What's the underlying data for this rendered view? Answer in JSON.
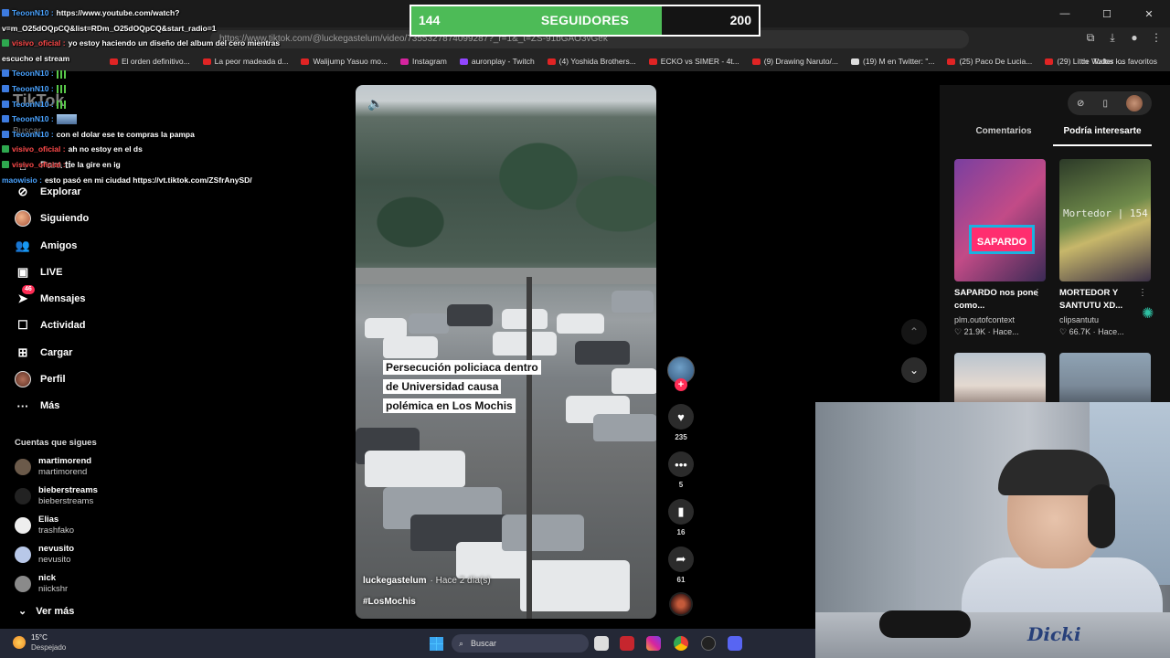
{
  "browser": {
    "url": "https://www.tiktok.com/@luckegastelum/video/7355327874099287?_r=1&_t=ZS-91bGAO3vGek",
    "window_controls": [
      "—",
      "☐",
      "✕"
    ],
    "bookmarks": [
      "El orden definitivo...",
      "La peor madeada d...",
      "Walijump Yasuo mo...",
      "Instagram",
      "auronplay - Twitch",
      "(4) Yoshida Brothers...",
      "ECKO vs SIMER - 4t...",
      "(9) Drawing Naruto/...",
      "(19) M en Twitter: \"...",
      "(25) Paco De Lucia...",
      "(29) Little Walter -..."
    ],
    "all_bookmarks": "Todos los favoritos"
  },
  "follower_goal": {
    "current": "144",
    "label": "SEGUIDORES",
    "goal": "200",
    "progress": 0.72,
    "fill_color": "#4dbb57"
  },
  "chat": [
    {
      "user": "TeoonN10 :",
      "msg": "https://www.youtube.com/watch?",
      "badge": "blue"
    },
    {
      "user": "",
      "msg": "v=m_O25dOQpCQ&list=RDm_O25dOQpCQ&start_radio=1",
      "badge": "none"
    },
    {
      "user": "visivo_oficial :",
      "msg": "yo estoy haciendo un diseño del album del cero mientras",
      "badge": "green"
    },
    {
      "user": "",
      "msg": "escucho el stream",
      "badge": "none"
    },
    {
      "user": "TeoonN10 :",
      "msg": "",
      "badge": "blue",
      "extra": "signal"
    },
    {
      "user": "TeoonN10 :",
      "msg": "",
      "badge": "blue",
      "extra": "signal"
    },
    {
      "user": "TeoonN10 :",
      "msg": "",
      "badge": "blue",
      "extra": "signal"
    },
    {
      "user": "TeoonN10 :",
      "msg": "",
      "badge": "blue",
      "extra": "emote"
    },
    {
      "user": "TeoonN10 :",
      "msg": "con el dolar ese te compras la pampa",
      "badge": "blue"
    },
    {
      "user": "visivo_oficial :",
      "msg": "ah no estoy en el ds",
      "badge": "green"
    },
    {
      "user": "visivo_oficial :",
      "msg": "te la gire en ig",
      "badge": "green"
    },
    {
      "user": "maowisio :",
      "msg": "esto pasó en mi ciudad https://vt.tiktok.com/ZSfrAnySD/",
      "badge": "none"
    }
  ],
  "tiktok": {
    "logo": "TikTok",
    "search_placeholder": "Buscar",
    "nav": [
      {
        "label": "Para ti",
        "icon": "home-icon"
      },
      {
        "label": "Explorar",
        "icon": "compass-icon"
      },
      {
        "label": "Siguiendo",
        "icon": "avatar-icon"
      },
      {
        "label": "Amigos",
        "icon": "friends-icon"
      },
      {
        "label": "LIVE",
        "icon": "live-icon"
      },
      {
        "label": "Mensajes",
        "icon": "messages-icon",
        "badge": "46"
      },
      {
        "label": "Actividad",
        "icon": "activity-icon"
      },
      {
        "label": "Cargar",
        "icon": "upload-icon"
      },
      {
        "label": "Perfil",
        "icon": "profile-icon"
      },
      {
        "label": "Más",
        "icon": "more-icon"
      }
    ],
    "following_title": "Cuentas que sigues",
    "following": [
      {
        "name": "martimorend",
        "handle": "martimorend"
      },
      {
        "name": "bieberstreams",
        "handle": "bieberstreams"
      },
      {
        "name": "Elias",
        "handle": "trashfako"
      },
      {
        "name": "nevusito",
        "handle": "nevusito"
      },
      {
        "name": "nick",
        "handle": "niickshr"
      }
    ],
    "see_more": "Ver más",
    "video": {
      "caption_lines": [
        "Persecución policiaca dentro",
        "de Universidad causa",
        "polémica en Los Mochis"
      ],
      "author": "luckegastelum",
      "posted": "· Hace 2 día(s)",
      "hashtag": "#LosMochis"
    },
    "actions": {
      "likes": "235",
      "comments": "5",
      "saves": "16",
      "shares": "61"
    },
    "right_tabs": [
      "Comentarios",
      "Podría interesarte"
    ],
    "active_tab": "Podría interesarte",
    "recommended": [
      {
        "title": "SAPARDO nos pone como...",
        "author": "plm.outofcontext",
        "stats": "♡ 21.9K · Hace...",
        "thumb_text": "SAPARDO"
      },
      {
        "title": "MORTEDOR Y SANTUTU XD...",
        "author": "clipsantutu",
        "stats": "♡ 66.7K · Hace...",
        "thumb_text": "Mortedor | 154"
      }
    ]
  },
  "webcam": {
    "shirt_text": "Dicki"
  },
  "taskbar": {
    "weather_temp": "15°C",
    "weather_desc": "Despejado",
    "search_placeholder": "Buscar"
  }
}
